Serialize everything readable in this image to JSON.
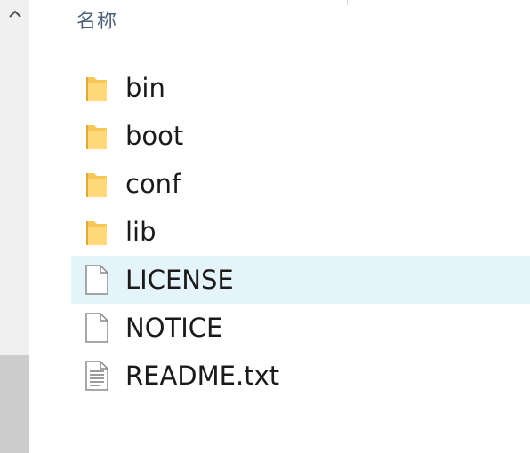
{
  "header": {
    "name_column": "名称"
  },
  "files": [
    {
      "name": "bin",
      "icon": "folder-icon",
      "type": "folder",
      "selected": false
    },
    {
      "name": "boot",
      "icon": "folder-icon",
      "type": "folder",
      "selected": false
    },
    {
      "name": "conf",
      "icon": "folder-icon",
      "type": "folder",
      "selected": false
    },
    {
      "name": "lib",
      "icon": "folder-icon",
      "type": "folder",
      "selected": false
    },
    {
      "name": "LICENSE",
      "icon": "blank-file-icon",
      "type": "file",
      "selected": true
    },
    {
      "name": "NOTICE",
      "icon": "blank-file-icon",
      "type": "file",
      "selected": false
    },
    {
      "name": "README.txt",
      "icon": "text-file-icon",
      "type": "file",
      "selected": false
    }
  ],
  "colors": {
    "folder": "#f6c85a",
    "selection": "#e5f3fb",
    "header_text": "#4c607a"
  },
  "scrollbar": {
    "up_icon": "chevron-up-icon"
  }
}
